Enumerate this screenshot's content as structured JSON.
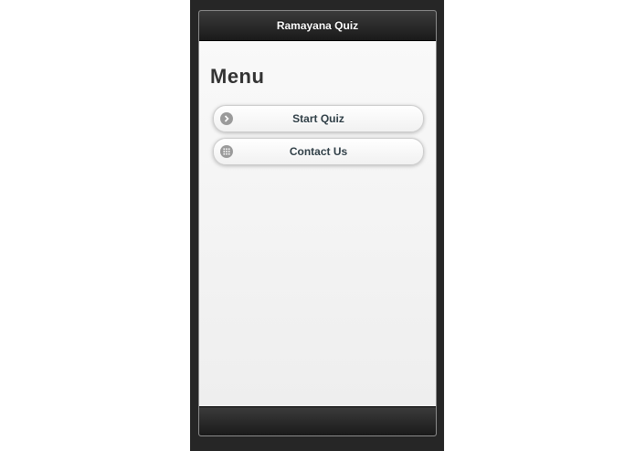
{
  "header": {
    "title": "Ramayana Quiz"
  },
  "main": {
    "title": "Menu",
    "buttons": [
      {
        "label": "Start Quiz",
        "icon": "arrow-right-icon"
      },
      {
        "label": "Contact Us",
        "icon": "grid-icon"
      }
    ]
  },
  "colors": {
    "header_bg": "#262626",
    "content_bg": "#f2f2f2",
    "button_text": "#2f3e46",
    "icon_bg": "#9a9a9a"
  }
}
